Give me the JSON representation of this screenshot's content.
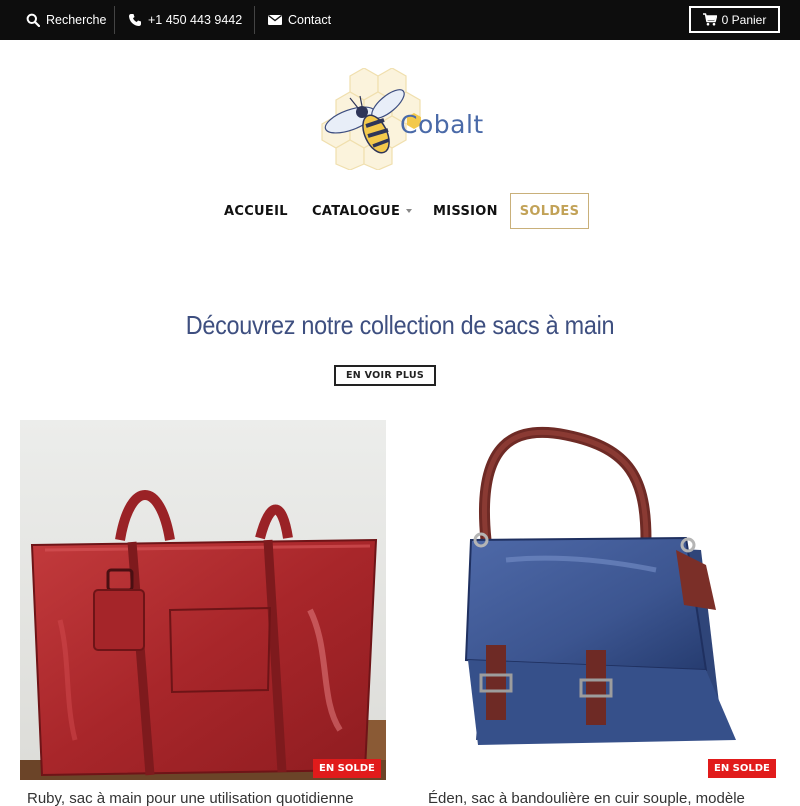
{
  "topbar": {
    "search_label": "Recherche",
    "phone_label": "+1 450 443 9442",
    "contact_label": "Contact",
    "cart_label": "0 Panier"
  },
  "brand": {
    "name": "Cobalt",
    "accent": "#4a6aa8",
    "honey": "#f3c94c"
  },
  "nav": {
    "items": [
      {
        "label": "ACCUEIL"
      },
      {
        "label": "CATALOGUE"
      },
      {
        "label": "MISSION"
      },
      {
        "label": "SOLDES"
      }
    ],
    "soldes_color": "#c2a257"
  },
  "hero": {
    "headline": "Découvrez notre collection de sacs à main",
    "button_label": "EN VOIR PLUS"
  },
  "products": [
    {
      "title": "Ruby, sac à main pour une utilisation quotidienne",
      "badge": "EN SOLDE",
      "color": "#b32a2d"
    },
    {
      "title": "Éden, sac à bandoulière en cuir souple, modèle",
      "badge": "EN SOLDE",
      "color": "#3c5590"
    }
  ],
  "badge_color": "#e11b1b"
}
